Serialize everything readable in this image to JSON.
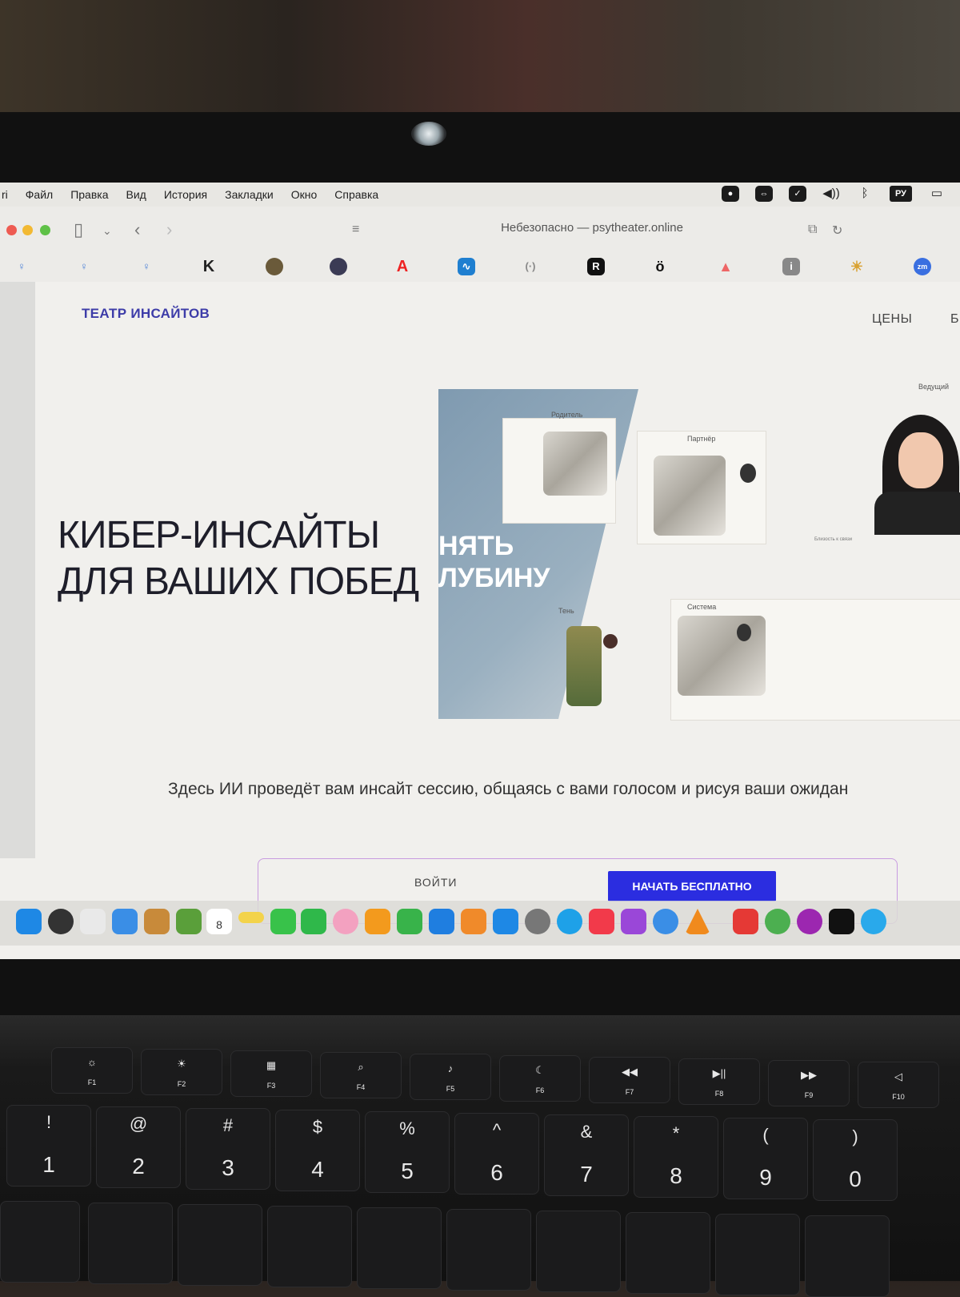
{
  "menubar": {
    "app": "ri",
    "items": [
      "Файл",
      "Правка",
      "Вид",
      "История",
      "Закладки",
      "Окно",
      "Справка"
    ],
    "language": "РУ"
  },
  "browser": {
    "address": "Небезопасно — psytheater.online"
  },
  "site": {
    "brand": "ТЕАТР ИНСАЙТОВ",
    "nav_prices": "ЦЕНЫ",
    "nav_partial": "Б",
    "hero_line1": "КИБЕР-ИНСАЙТЫ",
    "hero_line2": "ДЛЯ ВАШИХ ПОБЕД",
    "art_text_line1": "НЯТЬ",
    "art_text_line2": "ЛУБИНУ",
    "labels": {
      "parents": "Родитель",
      "partner": "Партнёр",
      "host": "Ведущий",
      "shadow": "Тень",
      "system": "Система",
      "closeness": "Близость к связи"
    },
    "description": "Здесь ИИ проведёт вам инсайт сессию, общаясь с вами голосом и рисуя ваши ожидан",
    "login_label": "ВОЙТИ",
    "start_label": "НАЧАТЬ БЕСПЛАТНО"
  },
  "dock": {
    "calendar_day": "8"
  },
  "keyboard": {
    "fkeys": [
      "F1",
      "F2",
      "F3",
      "F4",
      "F5",
      "F6",
      "F7",
      "F8",
      "F9",
      "F10"
    ],
    "numbers": [
      {
        "s": "!",
        "m": "1"
      },
      {
        "s": "@",
        "m": "2"
      },
      {
        "s": "#",
        "m": "3"
      },
      {
        "s": "$",
        "m": "4"
      },
      {
        "s": "%",
        "m": "5"
      },
      {
        "s": "^",
        "m": "6"
      },
      {
        "s": "&",
        "m": "7"
      },
      {
        "s": "*",
        "m": "8"
      },
      {
        "s": "(",
        "m": "9"
      },
      {
        "s": ")",
        "m": "0"
      }
    ]
  },
  "colors": {
    "brand": "#3d3ca8",
    "cta": "#2b2de0",
    "cta_border": "#c89be0"
  }
}
